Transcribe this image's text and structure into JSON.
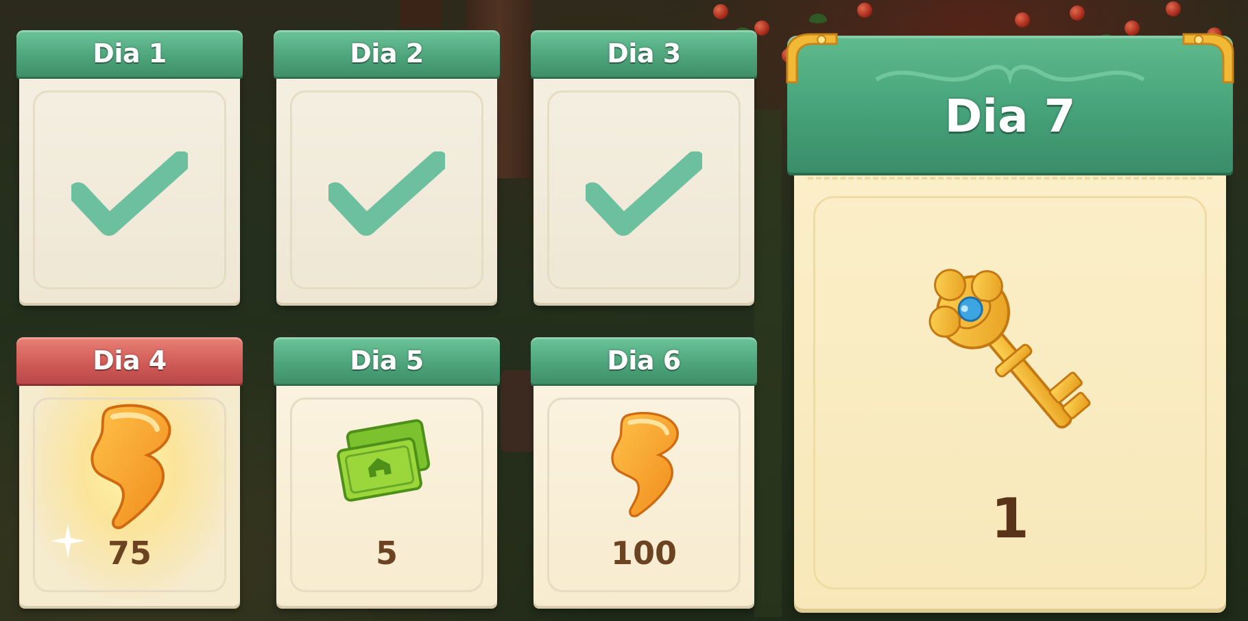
{
  "days": [
    {
      "title": "Dia 1",
      "status": "claimed"
    },
    {
      "title": "Dia 2",
      "status": "claimed"
    },
    {
      "title": "Dia 3",
      "status": "claimed"
    },
    {
      "title": "Dia 4",
      "status": "current",
      "reward": "energy-icon",
      "quantity": "75"
    },
    {
      "title": "Dia 5",
      "status": "locked",
      "reward": "cash-icon",
      "quantity": "5"
    },
    {
      "title": "Dia 6",
      "status": "locked",
      "reward": "energy-icon",
      "quantity": "100"
    },
    {
      "title": "Dia 7",
      "status": "locked",
      "reward": "golden-key-icon",
      "quantity": "1"
    }
  ],
  "colors": {
    "banner_green": "#4ca37a",
    "banner_red": "#cf5a55",
    "check": "#5dbb98",
    "quantity_text": "#6b4320"
  }
}
